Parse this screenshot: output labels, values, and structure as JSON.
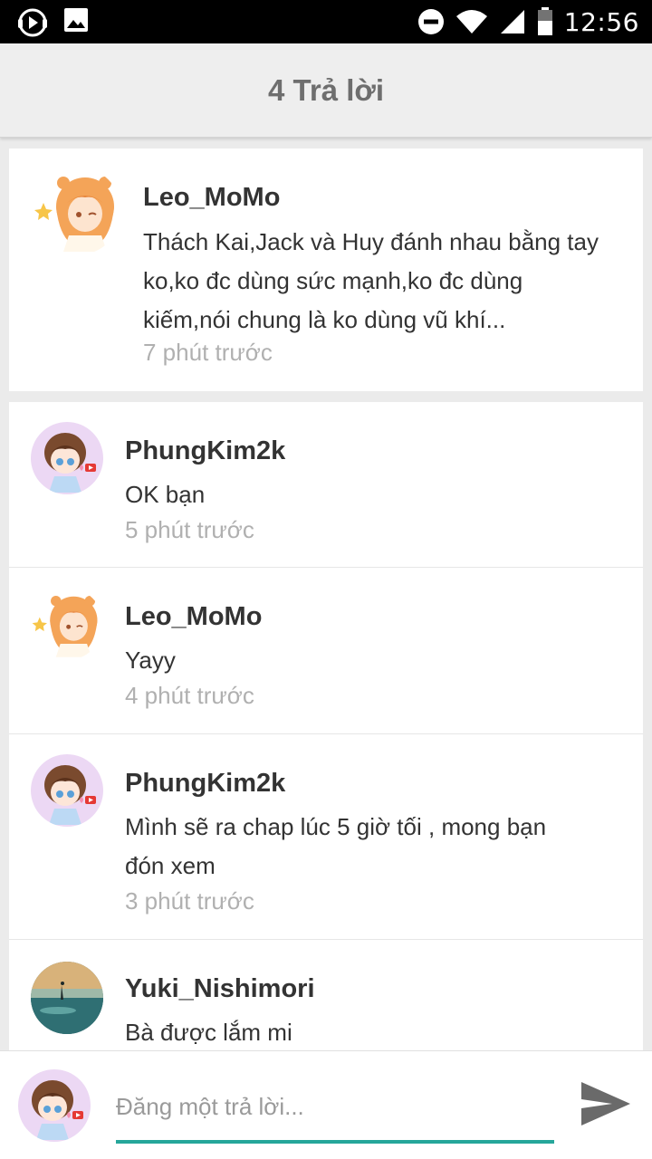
{
  "status_bar": {
    "time": "12:56",
    "left_icons": [
      "media-play-icon",
      "image-icon"
    ],
    "right_icons": [
      "do-not-disturb-icon",
      "wifi-icon",
      "cellular-signal-icon",
      "battery-icon"
    ]
  },
  "header": {
    "title": "4 Trả lời"
  },
  "post": {
    "author": "Leo_MoMo",
    "text": "Thách Kai,Jack và Huy đánh nhau bằng tay ko,ko đc dùng sức mạnh,ko đc dùng kiếm,nói chung là ko dùng vũ khí...",
    "time": "7 phút trước"
  },
  "replies": [
    {
      "author": "PhungKim2k",
      "text": "OK bạn",
      "time": "5 phút trước"
    },
    {
      "author": "Leo_MoMo",
      "text": "Yayy",
      "time": "4 phút trước"
    },
    {
      "author": "PhungKim2k",
      "text": "Mình sẽ ra chap lúc 5 giờ tối , mong bạn đón xem",
      "time": "3 phút trước"
    },
    {
      "author": "Yuki_Nishimori",
      "text": "Bà được lắm mi",
      "time": ""
    }
  ],
  "composer": {
    "placeholder": "Đăng một trả lời..."
  },
  "colors": {
    "accent": "#26a69a",
    "header_bg": "#eeeeee",
    "time_text": "#b0b0b0"
  }
}
